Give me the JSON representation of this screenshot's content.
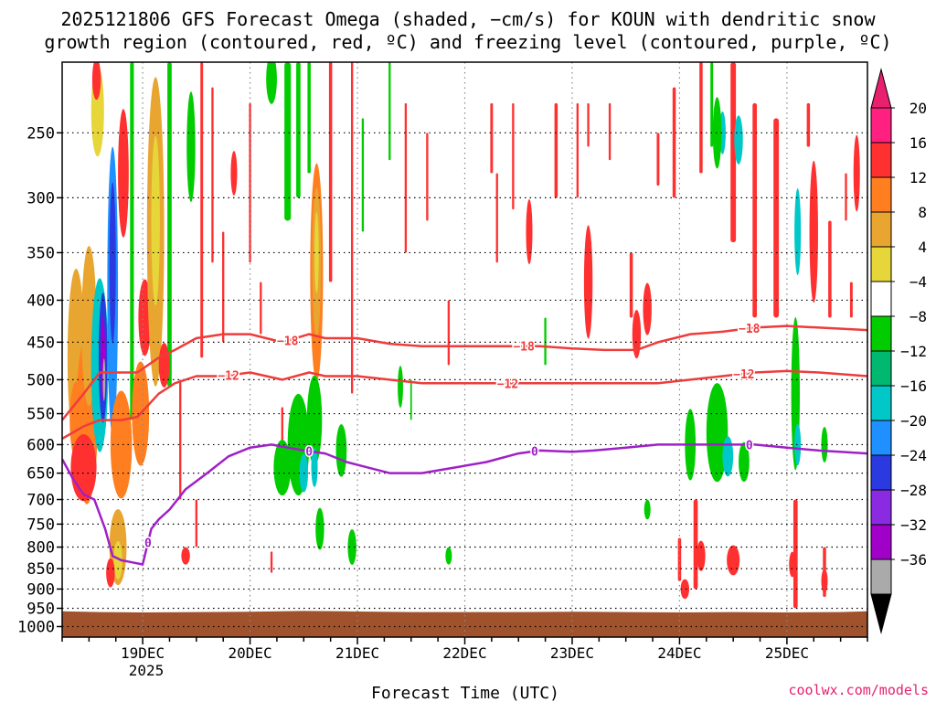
{
  "title_lines": [
    "2025121806 GFS Forecast Omega (shaded, −cm/s) for KOUN with dendritic snow",
    "growth region (contoured, red, ºC) and freezing level (contoured, purple, ºC)"
  ],
  "credit": "coolwx.com/models",
  "chart_data": {
    "type": "heatmap",
    "xlabel": "Forecast Time (UTC)",
    "ylabel": "",
    "y_scale": "log-pressure",
    "y_inverted": true,
    "ylim": [
      205,
      1030
    ],
    "xlim": [
      18.25,
      25.75
    ],
    "grid": true,
    "x_ticks": [
      {
        "value": 19,
        "label": "19DEC"
      },
      {
        "value": 20,
        "label": "20DEC"
      },
      {
        "value": 21,
        "label": "21DEC"
      },
      {
        "value": 22,
        "label": "22DEC"
      },
      {
        "value": 23,
        "label": "23DEC"
      },
      {
        "value": 24,
        "label": "24DEC"
      },
      {
        "value": 25,
        "label": "25DEC"
      }
    ],
    "x_year_label": "2025",
    "y_ticks": [
      250,
      300,
      350,
      400,
      450,
      500,
      550,
      600,
      650,
      700,
      750,
      800,
      850,
      900,
      950,
      1000
    ],
    "colorbar": {
      "labels": [
        "20",
        "16",
        "12",
        "8",
        "4",
        "−4",
        "−8",
        "−12",
        "−16",
        "−20",
        "−24",
        "−28",
        "−32",
        "−36"
      ],
      "colors": [
        "#ff2080",
        "#ff3030",
        "#ff7f20",
        "#e8a530",
        "#e6d63a",
        "#ffffff",
        "#00cc00",
        "#00b870",
        "#00c8c8",
        "#1e90ff",
        "#2a3ae0",
        "#8a2be2",
        "#a000c8",
        "#aaaaaa"
      ],
      "top_arrow_color": "#e8206e",
      "bottom_arrow_color": "#000000"
    },
    "omega_blobs": [
      {
        "t": 18.38,
        "p": 470,
        "dt": 0.08,
        "dp": 230,
        "c": 3
      },
      {
        "t": 18.38,
        "p": 560,
        "dt": 0.06,
        "dp": 120,
        "c": 2
      },
      {
        "t": 18.48,
        "p": 560,
        "dt": 0.1,
        "dp": 260,
        "c": 2
      },
      {
        "t": 18.5,
        "p": 430,
        "dt": 0.07,
        "dp": 190,
        "c": 3
      },
      {
        "t": 18.45,
        "p": 640,
        "dt": 0.12,
        "dp": 120,
        "c": 1
      },
      {
        "t": 18.58,
        "p": 235,
        "dt": 0.06,
        "dp": 60,
        "c": 4
      },
      {
        "t": 18.57,
        "p": 215,
        "dt": 0.04,
        "dp": 25,
        "c": 1
      },
      {
        "t": 18.6,
        "p": 480,
        "dt": 0.08,
        "dp": 230,
        "c": 8
      },
      {
        "t": 18.63,
        "p": 470,
        "dt": 0.04,
        "dp": 170,
        "c": 10
      },
      {
        "t": 18.63,
        "p": 470,
        "dt": 0.02,
        "dp": 110,
        "c": 12
      },
      {
        "t": 18.64,
        "p": 500,
        "dt": 0.012,
        "dp": 60,
        "c": 13
      },
      {
        "t": 18.72,
        "p": 390,
        "dt": 0.05,
        "dp": 300,
        "c": 9
      },
      {
        "t": 18.72,
        "p": 360,
        "dt": 0.03,
        "dp": 160,
        "c": 10
      },
      {
        "t": 18.8,
        "p": 600,
        "dt": 0.1,
        "dp": 180,
        "c": 2
      },
      {
        "t": 18.77,
        "p": 800,
        "dt": 0.08,
        "dp": 170,
        "c": 3
      },
      {
        "t": 18.77,
        "p": 830,
        "dt": 0.04,
        "dp": 90,
        "c": 4
      },
      {
        "t": 18.7,
        "p": 860,
        "dt": 0.04,
        "dp": 70,
        "c": 1
      },
      {
        "t": 18.82,
        "p": 280,
        "dt": 0.05,
        "dp": 100,
        "c": 1
      },
      {
        "t": 18.98,
        "p": 550,
        "dt": 0.08,
        "dp": 160,
        "c": 2
      },
      {
        "t": 19.02,
        "p": 420,
        "dt": 0.06,
        "dp": 90,
        "c": 1
      },
      {
        "t": 19.12,
        "p": 330,
        "dt": 0.08,
        "dp": 270,
        "c": 3
      },
      {
        "t": 19.12,
        "p": 320,
        "dt": 0.04,
        "dp": 150,
        "c": 4
      },
      {
        "t": 19.2,
        "p": 480,
        "dt": 0.05,
        "dp": 60,
        "c": 1
      },
      {
        "t": 19.45,
        "p": 260,
        "dt": 0.04,
        "dp": 80,
        "c": 6
      },
      {
        "t": 19.4,
        "p": 820,
        "dt": 0.04,
        "dp": 40,
        "c": 1
      },
      {
        "t": 19.85,
        "p": 280,
        "dt": 0.03,
        "dp": 35,
        "c": 1
      },
      {
        "t": 20.2,
        "p": 215,
        "dt": 0.05,
        "dp": 30,
        "c": 6
      },
      {
        "t": 20.3,
        "p": 640,
        "dt": 0.08,
        "dp": 100,
        "c": 6
      },
      {
        "t": 20.45,
        "p": 600,
        "dt": 0.1,
        "dp": 170,
        "c": 6
      },
      {
        "t": 20.5,
        "p": 650,
        "dt": 0.04,
        "dp": 70,
        "c": 8
      },
      {
        "t": 20.62,
        "p": 370,
        "dt": 0.06,
        "dp": 220,
        "c": 2
      },
      {
        "t": 20.62,
        "p": 360,
        "dt": 0.04,
        "dp": 150,
        "c": 3
      },
      {
        "t": 20.62,
        "p": 350,
        "dt": 0.02,
        "dp": 80,
        "c": 4
      },
      {
        "t": 20.6,
        "p": 560,
        "dt": 0.07,
        "dp": 140,
        "c": 6
      },
      {
        "t": 20.6,
        "p": 640,
        "dt": 0.03,
        "dp": 70,
        "c": 8
      },
      {
        "t": 20.65,
        "p": 760,
        "dt": 0.04,
        "dp": 90,
        "c": 6
      },
      {
        "t": 20.85,
        "p": 610,
        "dt": 0.05,
        "dp": 90,
        "c": 6
      },
      {
        "t": 20.95,
        "p": 800,
        "dt": 0.04,
        "dp": 80,
        "c": 6
      },
      {
        "t": 21.4,
        "p": 510,
        "dt": 0.025,
        "dp": 60,
        "c": 6
      },
      {
        "t": 21.85,
        "p": 820,
        "dt": 0.03,
        "dp": 40,
        "c": 6
      },
      {
        "t": 22.6,
        "p": 330,
        "dt": 0.03,
        "dp": 60,
        "c": 1
      },
      {
        "t": 23.15,
        "p": 380,
        "dt": 0.04,
        "dp": 120,
        "c": 1
      },
      {
        "t": 23.6,
        "p": 440,
        "dt": 0.04,
        "dp": 60,
        "c": 1
      },
      {
        "t": 23.7,
        "p": 410,
        "dt": 0.04,
        "dp": 60,
        "c": 1
      },
      {
        "t": 23.7,
        "p": 720,
        "dt": 0.03,
        "dp": 40,
        "c": 6
      },
      {
        "t": 24.1,
        "p": 600,
        "dt": 0.05,
        "dp": 120,
        "c": 6
      },
      {
        "t": 24.35,
        "p": 580,
        "dt": 0.1,
        "dp": 160,
        "c": 6
      },
      {
        "t": 24.45,
        "p": 620,
        "dt": 0.05,
        "dp": 70,
        "c": 8
      },
      {
        "t": 24.6,
        "p": 630,
        "dt": 0.05,
        "dp": 70,
        "c": 6
      },
      {
        "t": 24.2,
        "p": 820,
        "dt": 0.04,
        "dp": 70,
        "c": 1
      },
      {
        "t": 24.5,
        "p": 830,
        "dt": 0.06,
        "dp": 70,
        "c": 1
      },
      {
        "t": 24.4,
        "p": 250,
        "dt": 0.03,
        "dp": 30,
        "c": 8
      },
      {
        "t": 24.55,
        "p": 255,
        "dt": 0.04,
        "dp": 35,
        "c": 8
      },
      {
        "t": 24.35,
        "p": 250,
        "dt": 0.04,
        "dp": 50,
        "c": 6
      },
      {
        "t": 24.05,
        "p": 900,
        "dt": 0.04,
        "dp": 50,
        "c": 1
      },
      {
        "t": 25.08,
        "p": 520,
        "dt": 0.04,
        "dp": 220,
        "c": 6
      },
      {
        "t": 25.1,
        "p": 330,
        "dt": 0.03,
        "dp": 80,
        "c": 8
      },
      {
        "t": 25.1,
        "p": 600,
        "dt": 0.03,
        "dp": 70,
        "c": 8
      },
      {
        "t": 25.35,
        "p": 600,
        "dt": 0.03,
        "dp": 60,
        "c": 6
      },
      {
        "t": 25.25,
        "p": 330,
        "dt": 0.04,
        "dp": 130,
        "c": 1
      },
      {
        "t": 25.05,
        "p": 840,
        "dt": 0.03,
        "dp": 60,
        "c": 1
      },
      {
        "t": 25.35,
        "p": 880,
        "dt": 0.03,
        "dp": 60,
        "c": 1
      },
      {
        "t": 25.65,
        "p": 280,
        "dt": 0.03,
        "dp": 60,
        "c": 1
      }
    ],
    "omega_streaks": [
      {
        "t": 18.9,
        "p1": 205,
        "p2": 560,
        "w": 0.035,
        "c": 6
      },
      {
        "t": 19.25,
        "p1": 205,
        "p2": 510,
        "w": 0.04,
        "c": 6
      },
      {
        "t": 19.55,
        "p1": 205,
        "p2": 470,
        "w": 0.025,
        "c": 1
      },
      {
        "t": 19.65,
        "p1": 220,
        "p2": 360,
        "w": 0.02,
        "c": 1
      },
      {
        "t": 19.75,
        "p1": 330,
        "p2": 450,
        "w": 0.02,
        "c": 1
      },
      {
        "t": 20.0,
        "p1": 230,
        "p2": 360,
        "w": 0.02,
        "c": 1
      },
      {
        "t": 20.1,
        "p1": 380,
        "p2": 440,
        "w": 0.02,
        "c": 1
      },
      {
        "t": 20.35,
        "p1": 205,
        "p2": 320,
        "w": 0.06,
        "c": 6
      },
      {
        "t": 20.45,
        "p1": 205,
        "p2": 300,
        "w": 0.04,
        "c": 6
      },
      {
        "t": 20.55,
        "p1": 205,
        "p2": 280,
        "w": 0.03,
        "c": 6
      },
      {
        "t": 20.75,
        "p1": 205,
        "p2": 380,
        "w": 0.03,
        "c": 1
      },
      {
        "t": 20.95,
        "p1": 205,
        "p2": 520,
        "w": 0.02,
        "c": 1
      },
      {
        "t": 21.05,
        "p1": 240,
        "p2": 330,
        "w": 0.02,
        "c": 6
      },
      {
        "t": 21.3,
        "p1": 205,
        "p2": 270,
        "w": 0.02,
        "c": 6
      },
      {
        "t": 21.45,
        "p1": 230,
        "p2": 350,
        "w": 0.02,
        "c": 1
      },
      {
        "t": 21.65,
        "p1": 250,
        "p2": 320,
        "w": 0.02,
        "c": 1
      },
      {
        "t": 21.85,
        "p1": 400,
        "p2": 480,
        "w": 0.02,
        "c": 1
      },
      {
        "t": 22.25,
        "p1": 230,
        "p2": 280,
        "w": 0.025,
        "c": 1
      },
      {
        "t": 22.3,
        "p1": 280,
        "p2": 360,
        "w": 0.02,
        "c": 1
      },
      {
        "t": 22.45,
        "p1": 230,
        "p2": 310,
        "w": 0.02,
        "c": 1
      },
      {
        "t": 22.75,
        "p1": 420,
        "p2": 480,
        "w": 0.02,
        "c": 6
      },
      {
        "t": 22.85,
        "p1": 230,
        "p2": 300,
        "w": 0.03,
        "c": 1
      },
      {
        "t": 23.05,
        "p1": 230,
        "p2": 300,
        "w": 0.02,
        "c": 1
      },
      {
        "t": 23.15,
        "p1": 230,
        "p2": 260,
        "w": 0.02,
        "c": 1
      },
      {
        "t": 23.35,
        "p1": 230,
        "p2": 270,
        "w": 0.02,
        "c": 1
      },
      {
        "t": 23.55,
        "p1": 350,
        "p2": 420,
        "w": 0.03,
        "c": 1
      },
      {
        "t": 23.8,
        "p1": 250,
        "p2": 290,
        "w": 0.025,
        "c": 1
      },
      {
        "t": 23.95,
        "p1": 220,
        "p2": 300,
        "w": 0.03,
        "c": 1
      },
      {
        "t": 24.2,
        "p1": 205,
        "p2": 280,
        "w": 0.03,
        "c": 1
      },
      {
        "t": 24.3,
        "p1": 205,
        "p2": 260,
        "w": 0.025,
        "c": 6
      },
      {
        "t": 24.5,
        "p1": 205,
        "p2": 340,
        "w": 0.05,
        "c": 1
      },
      {
        "t": 24.7,
        "p1": 230,
        "p2": 420,
        "w": 0.04,
        "c": 1
      },
      {
        "t": 24.9,
        "p1": 240,
        "p2": 420,
        "w": 0.05,
        "c": 1
      },
      {
        "t": 25.2,
        "p1": 230,
        "p2": 260,
        "w": 0.03,
        "c": 1
      },
      {
        "t": 25.4,
        "p1": 320,
        "p2": 420,
        "w": 0.03,
        "c": 1
      },
      {
        "t": 25.6,
        "p1": 380,
        "p2": 420,
        "w": 0.025,
        "c": 1
      },
      {
        "t": 25.55,
        "p1": 280,
        "p2": 320,
        "w": 0.02,
        "c": 1
      },
      {
        "t": 24.15,
        "p1": 700,
        "p2": 900,
        "w": 0.04,
        "c": 1
      },
      {
        "t": 24.0,
        "p1": 780,
        "p2": 880,
        "w": 0.03,
        "c": 1
      },
      {
        "t": 25.08,
        "p1": 700,
        "p2": 950,
        "w": 0.04,
        "c": 1
      },
      {
        "t": 25.35,
        "p1": 800,
        "p2": 920,
        "w": 0.03,
        "c": 1
      },
      {
        "t": 21.5,
        "p1": 500,
        "p2": 560,
        "w": 0.015,
        "c": 6
      },
      {
        "t": 20.3,
        "p1": 540,
        "p2": 680,
        "w": 0.02,
        "c": 1
      },
      {
        "t": 19.35,
        "p1": 500,
        "p2": 700,
        "w": 0.02,
        "c": 1
      },
      {
        "t": 19.5,
        "p1": 700,
        "p2": 800,
        "w": 0.02,
        "c": 1
      },
      {
        "t": 20.2,
        "p1": 810,
        "p2": 860,
        "w": 0.02,
        "c": 1
      }
    ],
    "iso_minus18": {
      "label": "−18",
      "color": "#ee3c3c",
      "t": [
        18.25,
        18.45,
        18.6,
        18.75,
        18.95,
        19.15,
        19.3,
        19.5,
        19.75,
        20.0,
        20.3,
        20.55,
        20.7,
        21.0,
        21.3,
        21.6,
        22.0,
        22.4,
        22.7,
        23.0,
        23.3,
        23.6,
        23.8,
        24.1,
        24.4,
        24.7,
        25.0,
        25.3,
        25.75
      ],
      "p": [
        560,
        520,
        490,
        490,
        490,
        470,
        460,
        445,
        440,
        440,
        450,
        440,
        445,
        445,
        452,
        455,
        455,
        455,
        455,
        458,
        460,
        460,
        450,
        440,
        437,
        432,
        430,
        432,
        435
      ]
    },
    "iso_minus12": {
      "label": "−12",
      "color": "#ee3c3c",
      "t": [
        18.25,
        18.45,
        18.6,
        18.8,
        18.95,
        19.15,
        19.3,
        19.5,
        19.75,
        20.0,
        20.3,
        20.55,
        20.7,
        21.0,
        21.3,
        21.6,
        22.0,
        22.4,
        22.7,
        23.0,
        23.3,
        23.6,
        23.8,
        24.1,
        24.4,
        24.7,
        25.0,
        25.3,
        25.75
      ],
      "p": [
        590,
        570,
        560,
        560,
        555,
        520,
        505,
        495,
        495,
        490,
        500,
        490,
        495,
        495,
        500,
        505,
        505,
        505,
        505,
        505,
        505,
        505,
        505,
        500,
        495,
        490,
        488,
        490,
        495
      ]
    },
    "iso_0": {
      "label": "0",
      "color": "#a020c8",
      "t": [
        18.25,
        18.35,
        18.45,
        18.55,
        18.65,
        18.72,
        18.8,
        18.9,
        19.0,
        19.08,
        19.15,
        19.25,
        19.4,
        19.6,
        19.8,
        20.0,
        20.2,
        20.5,
        20.7,
        20.9,
        21.1,
        21.3,
        21.6,
        21.9,
        22.2,
        22.5,
        22.7,
        23.0,
        23.2,
        23.5,
        23.8,
        24.1,
        24.4,
        24.7,
        25.0,
        25.3,
        25.75
      ],
      "p": [
        625,
        660,
        690,
        700,
        760,
        820,
        830,
        835,
        840,
        760,
        740,
        720,
        680,
        650,
        620,
        605,
        600,
        610,
        615,
        630,
        640,
        650,
        650,
        640,
        630,
        615,
        610,
        612,
        610,
        605,
        600,
        600,
        600,
        600,
        605,
        610,
        615
      ]
    },
    "surface_pressure": {
      "color": "#a0522d",
      "t": [
        18.25,
        18.6,
        19.0,
        19.5,
        20.0,
        20.5,
        20.9,
        21.5,
        22.0,
        22.5,
        23.0,
        23.5,
        24.0,
        24.5,
        25.0,
        25.5,
        25.75
      ],
      "p": [
        958,
        960,
        961,
        960,
        959,
        957,
        958,
        960,
        960,
        960,
        959,
        960,
        961,
        960,
        961,
        960,
        958
      ]
    }
  }
}
